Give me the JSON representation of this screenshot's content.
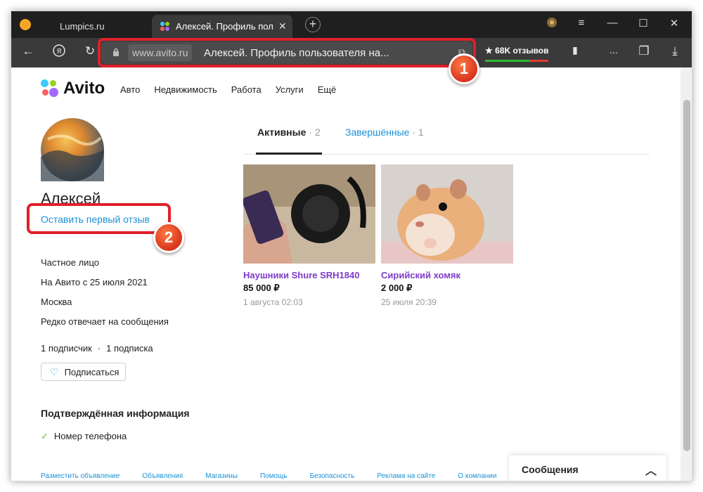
{
  "browser": {
    "tabs": [
      {
        "title": "Lumpics.ru"
      },
      {
        "title": "Алексей. Профиль пол",
        "close": "✕"
      }
    ],
    "new_tab": "+",
    "address": {
      "domain": "www.avito.ru",
      "title": "Алексей. Профиль пользователя на..."
    },
    "reviews_badge": "★ 68K отзывов",
    "overflow_label": "...",
    "annotations": [
      "1",
      "2"
    ]
  },
  "site": {
    "brand": "Avito",
    "nav": [
      "Авто",
      "Недвижимость",
      "Работа",
      "Услуги",
      "Ещё"
    ]
  },
  "profile": {
    "name": "Алексей",
    "review_link": "Оставить первый отзыв",
    "info": [
      "Частное лицо",
      "На Авито с 25 июля 2021",
      "Москва",
      "Редко отвечает на сообщения"
    ],
    "subscribers": "1 подписчик",
    "separator": "·",
    "subscriptions": "1 подписка",
    "subscribe_button": "Подписаться",
    "verified_title": "Подтверждённая информация",
    "verified_items": [
      "Номер телефона"
    ]
  },
  "listings_tabs": [
    {
      "label": "Активные",
      "count": "· 2"
    },
    {
      "label": "Завершённые",
      "count": "· 1"
    }
  ],
  "listings": [
    {
      "title": "Наушники Shure SRH1840",
      "price": "85 000 ₽",
      "date": "1 августа 02:03"
    },
    {
      "title": "Сирийский хомяк",
      "price": "2 000 ₽",
      "date": "25 июля 20:39"
    }
  ],
  "footer": [
    "Разместить объявление",
    "Объявления",
    "Магазины",
    "Помощь",
    "Безопасность",
    "Реклама на сайте",
    "О компании"
  ],
  "messages_widget": {
    "label": "Сообщения"
  },
  "colors": {
    "accent": "#1a91d6",
    "listing_title": "#7d3bc9",
    "highlight": "#e0202a"
  }
}
